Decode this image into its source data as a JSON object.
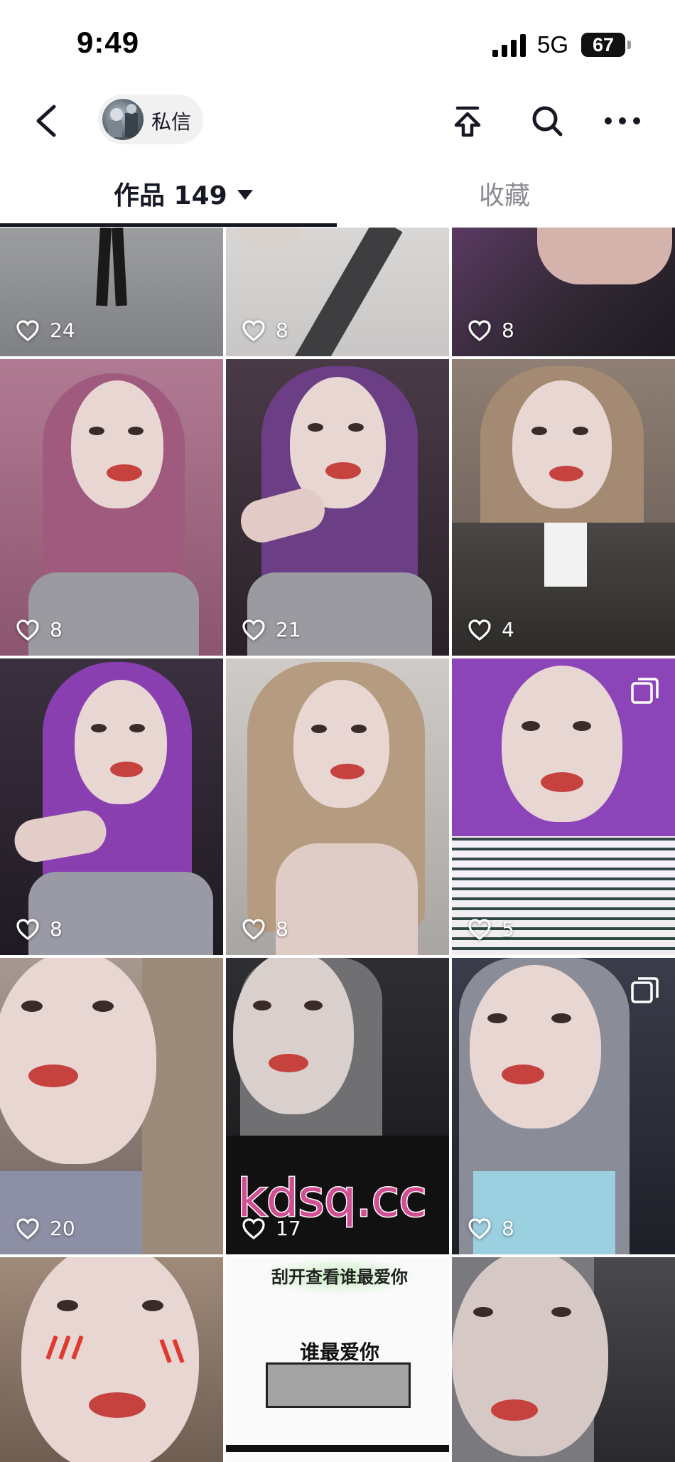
{
  "status_bar": {
    "time": "9:49",
    "network": "5G",
    "battery": "67"
  },
  "nav": {
    "dm_label": "私信",
    "icons": [
      "back-icon",
      "pin-top-icon",
      "search-icon",
      "more-icon"
    ]
  },
  "tabs": {
    "works_label": "作品 149",
    "favorites_label": "收藏"
  },
  "grid": {
    "tiles": [
      {
        "likes": "24"
      },
      {
        "likes": "8"
      },
      {
        "likes": "8"
      },
      {
        "likes": "8"
      },
      {
        "likes": "21"
      },
      {
        "likes": "4"
      },
      {
        "likes": "8"
      },
      {
        "likes": "8"
      },
      {
        "likes": "5",
        "multi": true
      },
      {
        "likes": "20"
      },
      {
        "likes": "17"
      },
      {
        "likes": "8",
        "multi": true
      },
      {
        "likes": ""
      },
      {
        "likes": ""
      },
      {
        "likes": ""
      }
    ]
  },
  "quiz_tile": {
    "top_text": "刮开查看谁最爱你",
    "middle_text": "谁最爱你"
  },
  "watermark": "kdsq.cc",
  "colors": {
    "accent": "#161823",
    "muted": "#8a8b91",
    "lips": "#c6423f",
    "watermark": "#d04f92"
  }
}
